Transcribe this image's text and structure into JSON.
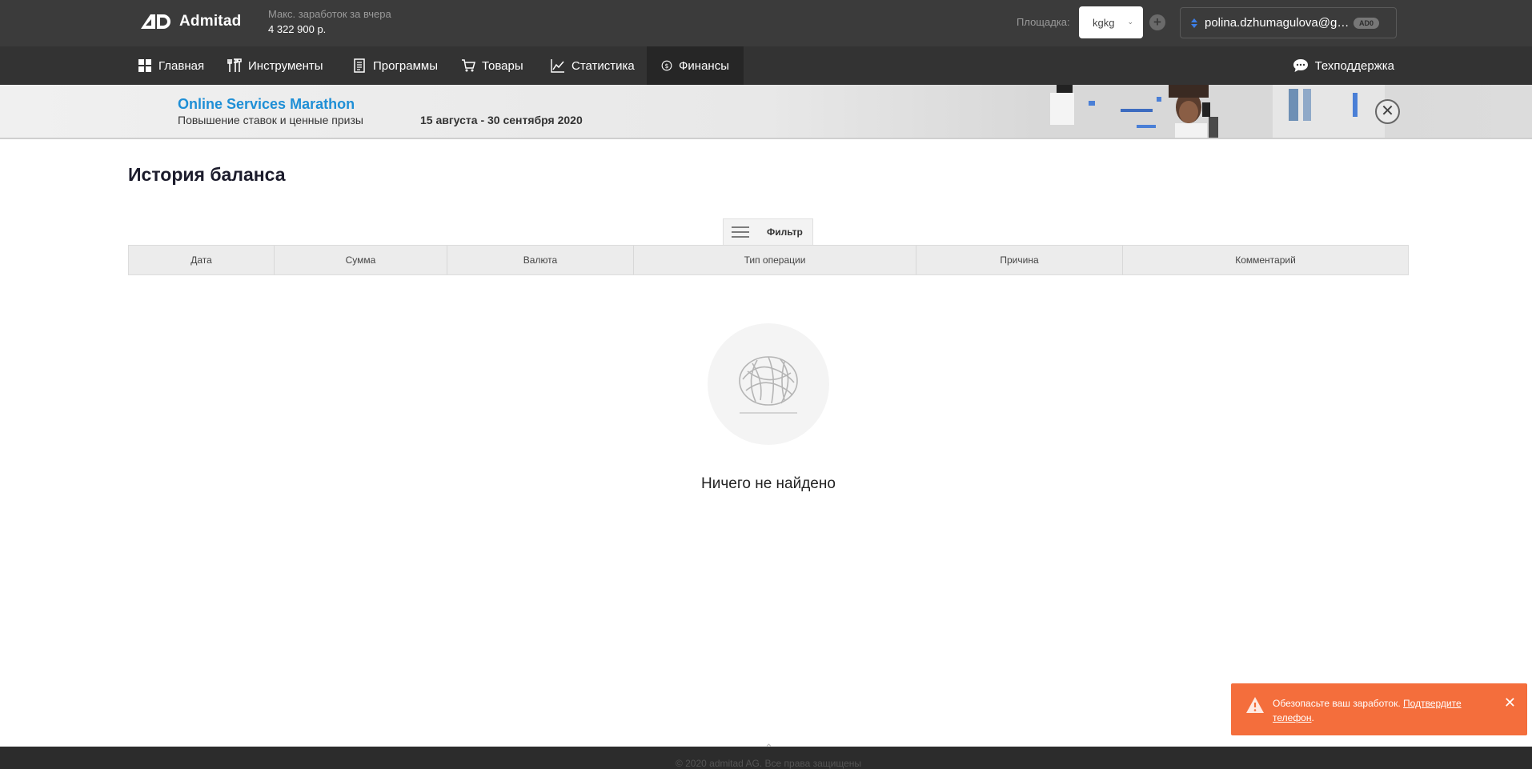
{
  "header": {
    "logo_text": "Admitad",
    "earn_label": "Макс. заработок за вчера",
    "earn_value": "4 322 900 р.",
    "platform_label": "Площадка:",
    "platform_value": "kgkg",
    "account_email": "polina.dzhumagulova@g…",
    "account_badge": "AD0"
  },
  "nav": {
    "items": [
      {
        "label": "Главная",
        "icon": "grid-icon"
      },
      {
        "label": "Инструменты",
        "icon": "tools-icon"
      },
      {
        "label": "Программы",
        "icon": "document-icon"
      },
      {
        "label": "Товары",
        "icon": "cart-icon"
      },
      {
        "label": "Статистика",
        "icon": "chart-line-icon"
      },
      {
        "label": "Финансы",
        "icon": "dollar-circle-icon",
        "active": true
      }
    ],
    "support_label": "Техподдержка"
  },
  "banner": {
    "title": "Online Services Marathon",
    "subtitle": "Повышение ставок и ценные призы",
    "dates": "15 августа - 30 сентября 2020"
  },
  "page": {
    "title": "История баланса",
    "filter_label": "Фильтр",
    "columns": [
      "Дата",
      "Сумма",
      "Валюта",
      "Тип операции",
      "Причина",
      "Комментарий"
    ],
    "empty_text": "Ничего не найдено"
  },
  "toast": {
    "text": "Обезопасьте ваш заработок.",
    "link": "Подтвердите телефон",
    "suffix": "."
  },
  "footer": {
    "text": "© 2020 admitad AG. Все права защищены"
  },
  "colors": {
    "topbar": "#3b3b3b",
    "nav": "#333333",
    "accent_blue": "#1f8fd6",
    "toast": "#f46e3c"
  }
}
